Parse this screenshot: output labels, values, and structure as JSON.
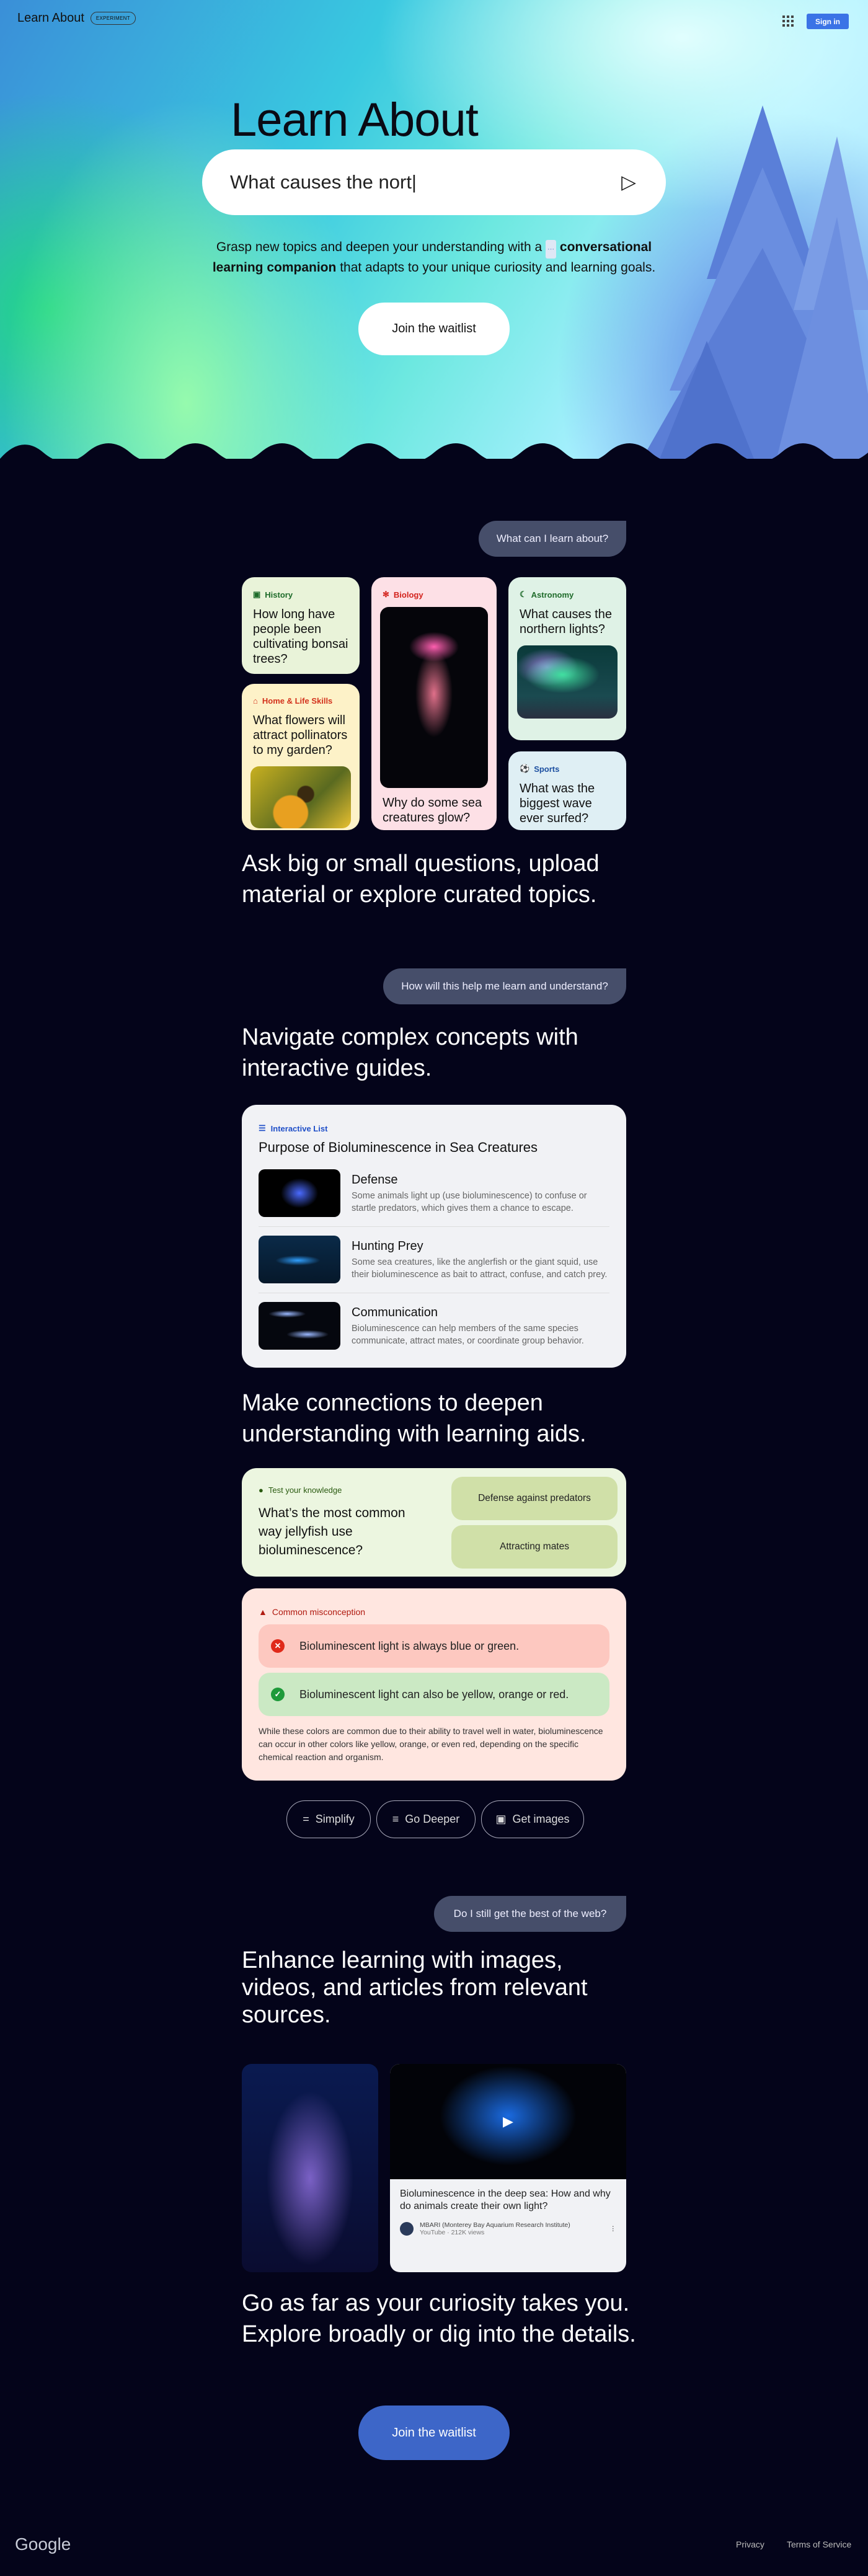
{
  "header": {
    "brand": "Learn About",
    "badge": "EXPERIMENT",
    "apps_icon": "apps-grid-icon",
    "sign_in": "Sign in"
  },
  "hero": {
    "title": "Learn About",
    "search_value": "What causes the nort|",
    "send_icon": "send-icon",
    "subtitle_pre": "Grasp new topics and deepen your understanding with a",
    "subtitle_bold": "conversational learning companion",
    "subtitle_post": "that adapts to your unique curiosity and learning goals.",
    "join": "Join the waitlist"
  },
  "section1": {
    "bubble": "What can I learn about?",
    "cards": [
      {
        "category": "History",
        "question": "How long have people been cultivating bonsai trees?",
        "color": "#1e6b2a"
      },
      {
        "category": "Home & Life Skills",
        "question": "What flowers will attract pollinators to my garden?",
        "color": "#d3321c"
      },
      {
        "category": "Biology",
        "question": "Why do some sea creatures glow?",
        "color": "#d3221c"
      },
      {
        "category": "Astronomy",
        "question": "What causes the northern lights?",
        "color": "#1e6b2a"
      },
      {
        "category": "Sports",
        "question": "What was the biggest wave ever surfed?",
        "color": "#1c4fa0"
      }
    ],
    "heading": "Ask big or small questions, upload material or explore curated topics."
  },
  "section2": {
    "bubble": "How will this help me learn and understand?",
    "heading": "Navigate complex concepts with interactive guides.",
    "list_label": "Interactive List",
    "list_title": "Purpose of Bioluminescence in Sea Creatures",
    "items": [
      {
        "title": "Defense",
        "desc": "Some animals light up (use bioluminescence) to confuse or startle predators, which gives them a chance to escape."
      },
      {
        "title": "Hunting Prey",
        "desc": "Some sea creatures, like the anglerfish or the giant squid, use their bioluminescence as bait to attract, confuse, and catch prey."
      },
      {
        "title": "Communication",
        "desc": "Bioluminescence can help members of the same species communicate, attract mates, or coordinate group behavior."
      }
    ]
  },
  "section3": {
    "heading": "Make connections to deepen understanding with learning aids.",
    "quiz_label": "Test your knowledge",
    "quiz_question": "What’s the most common way jellyfish use bioluminescence?",
    "options": [
      "Defense against predators",
      "Attracting mates"
    ],
    "mis_label": "Common misconception",
    "wrong": "Bioluminescent light is always blue or green.",
    "right": "Bioluminescent light can also be yellow, orange or red.",
    "explanation": "While these colors are common due to their ability to travel well in water, bioluminescence can occur in other colors like yellow, orange, or even red, depending on the specific chemical reaction and organism.",
    "chips": [
      "Simplify",
      "Go Deeper",
      "Get images"
    ]
  },
  "section4": {
    "bubble": "Do I still get the best of the web?",
    "heading": "Enhance learning with images, videos, and articles from relevant sources.",
    "video_title": "Bioluminescence in the deep sea: How and why do animals create their own light?",
    "channel": "MBARI (Monterey Bay Aquarium Research Institute)",
    "meta": "YouTube · 212K views"
  },
  "closing": {
    "heading": "Go as far as your curiosity takes you. Explore broadly or dig into the details.",
    "join": "Join the waitlist"
  },
  "footer": {
    "logo": "Google",
    "privacy": "Privacy",
    "terms": "Terms of Service"
  }
}
